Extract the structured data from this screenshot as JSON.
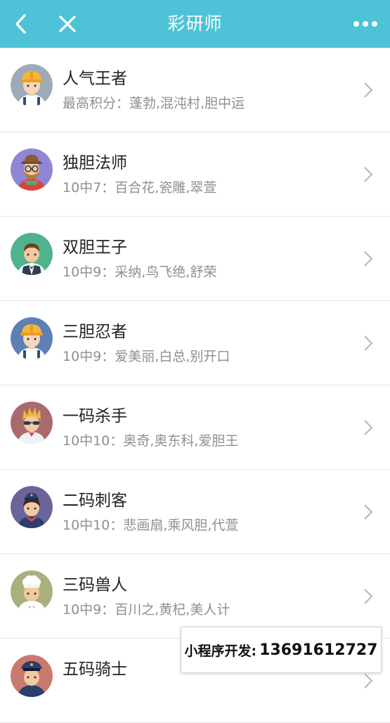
{
  "header": {
    "title": "彩研师",
    "bg_color": "#4ec3d8",
    "back_icon": "chevron-left-icon",
    "close_icon": "close-icon",
    "more_icon": "more-dots-icon"
  },
  "items": [
    {
      "name": "人气王者",
      "desc": "最高积分：蓬勃,混沌村,胆中运",
      "avatar": "worker-hardhat",
      "avatar_bg": "#9eaab9"
    },
    {
      "name": "独胆法师",
      "desc": "10中7：百合花,瓷雕,翠萱",
      "avatar": "hat-glasses-beard",
      "avatar_bg": "#8e86d6"
    },
    {
      "name": "双胆王子",
      "desc": "10中9：采纳,鸟飞绝,舒荣",
      "avatar": "waiter-vest",
      "avatar_bg": "#4fb38c"
    },
    {
      "name": "三胆忍者",
      "desc": "10中9：爱美丽,白总,别开口",
      "avatar": "worker-hardhat",
      "avatar_bg": "#5e7fb6"
    },
    {
      "name": "一码杀手",
      "desc": "10中10：奥奇,奥东科,爱胆王",
      "avatar": "spiky-hair-sunglasses",
      "avatar_bg": "#a86a6a"
    },
    {
      "name": "二码刺客",
      "desc": "10中10：悲画扇,乘风胆,代萱",
      "avatar": "flight-attendant",
      "avatar_bg": "#6a6598"
    },
    {
      "name": "三码兽人",
      "desc": "10中9：百川之,黄杞,美人计",
      "avatar": "chef",
      "avatar_bg": "#a9b07c"
    },
    {
      "name": "五码骑士",
      "desc": "",
      "avatar": "police-cap",
      "avatar_bg": "#c87a6c"
    }
  ],
  "contact_banner": {
    "label": "小程序开发:",
    "phone": "13691612727"
  }
}
